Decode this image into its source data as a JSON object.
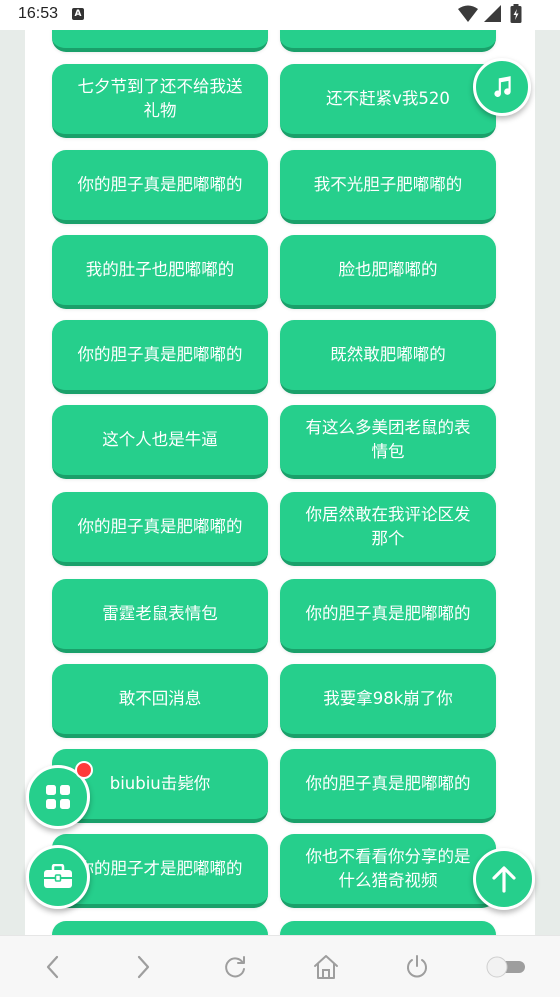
{
  "status_bar": {
    "time": "16:53",
    "app_icon_glyph": "A",
    "icons": [
      "wifi-icon",
      "signal-icon",
      "battery-charging-icon"
    ]
  },
  "tiles": [
    "",
    "",
    "七夕节到了还不给我送礼物",
    "还不赶紧v我520",
    "你的胆子真是肥嘟嘟的",
    "我不光胆子肥嘟嘟的",
    "我的肚子也肥嘟嘟的",
    "脸也肥嘟嘟的",
    "你的胆子真是肥嘟嘟的",
    "既然敢肥嘟嘟的",
    "这个人也是牛逼",
    "有这么多美团老鼠的表情包",
    "你的胆子真是肥嘟嘟的",
    "你居然敢在我评论区发那个",
    "雷霆老鼠表情包",
    "你的胆子真是肥嘟嘟的",
    "敢不回消息",
    "我要拿98k崩了你",
    "biubiu击毙你",
    "你的胆子真是肥嘟嘟的",
    "你的胆子才是肥嘟嘟的",
    "你也不看看你分享的是什么猎奇视频",
    "",
    ""
  ],
  "floating_buttons": {
    "music": "music-note-icon",
    "apps": "grid-apps-icon",
    "toolbox": "toolbox-icon",
    "scroll_top": "arrow-up-icon"
  },
  "bottom_nav": [
    "back-icon",
    "forward-icon",
    "refresh-icon",
    "home-icon",
    "power-icon",
    "toggle-switch"
  ],
  "colors": {
    "tile": "#26cf8c",
    "tile_shadow": "#1aa06a",
    "badge": "#ff3b3b"
  }
}
